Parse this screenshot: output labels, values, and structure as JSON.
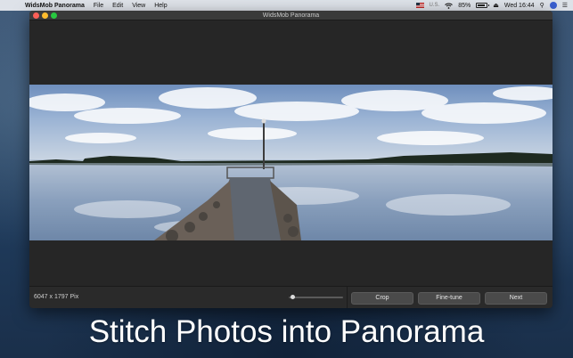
{
  "menubar": {
    "apple_icon": "apple-icon",
    "app_name": "WidsMob Panorama",
    "menus": [
      "File",
      "Edit",
      "View",
      "Help"
    ],
    "input_source": "U.S.",
    "battery": "85%",
    "clock": "Wed 16:44"
  },
  "window": {
    "title": "WidsMob Panorama"
  },
  "image_info": {
    "resolution": "6047 x 1797 Pix"
  },
  "zoom_slider": {
    "value": 0.03
  },
  "buttons": {
    "crop": "Crop",
    "fine_tune": "Fine-tune",
    "next": "Next"
  },
  "caption": "Stitch Photos into Panorama",
  "colors": {
    "window_bg": "#262626",
    "button_bg": "#4a4a4a",
    "close": "#fc5f57",
    "minimize": "#fdbc2e",
    "maximize": "#28c840"
  }
}
